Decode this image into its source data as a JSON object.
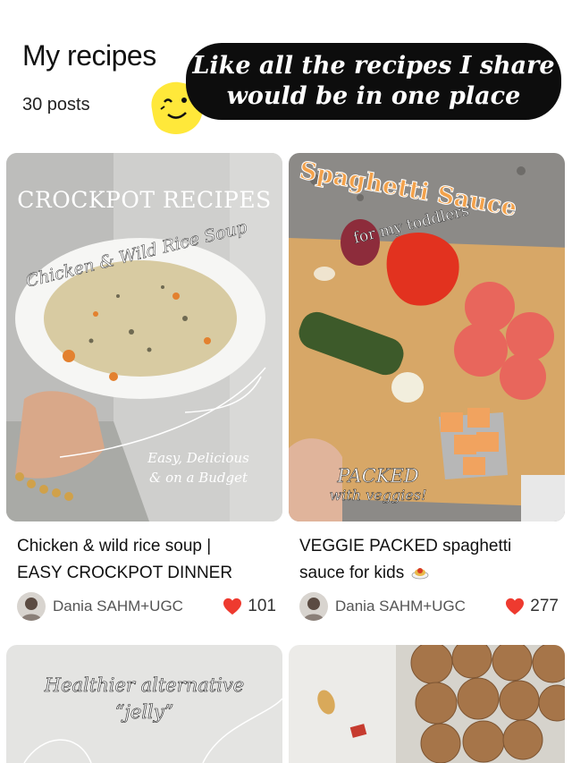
{
  "header": {
    "title": "My recipes",
    "posts_count": "30 posts",
    "banner_line1": "Like all the recipes I share",
    "banner_line2": "would be in one place",
    "emoji_icon": "winking-face-emoji"
  },
  "cards": [
    {
      "image_title": "CROCKPOT RECIPES",
      "image_script": "Chicken & Wild Rice Soup",
      "image_tag1": "Easy, Delicious",
      "image_tag2": "& on a Budget",
      "caption_line1": "Chicken & wild rice soup |",
      "caption_line2": "EASY CROCKPOT DINNER",
      "author": "Dania SAHM+UGC",
      "likes": "101"
    },
    {
      "image_title": "Spaghetti Sauce",
      "image_sub": "for my toddlers",
      "image_tag1": "PACKED",
      "image_tag2": "with veggies!",
      "caption_line1": "VEGGIE PACKED spaghetti",
      "caption_line2": "sauce for kids",
      "caption_emoji": "spaghetti-emoji",
      "author": "Dania SAHM+UGC",
      "likes": "277"
    },
    {
      "image_title_line1": "Healthier alternative",
      "image_title_line2": "“jelly”"
    },
    {
      "image_desc_icon": "peanut-icon"
    }
  ],
  "colors": {
    "heart": "#ee3a2f",
    "banner_bg": "#0d0d0d",
    "emoji_yellow": "#ffe83a"
  }
}
